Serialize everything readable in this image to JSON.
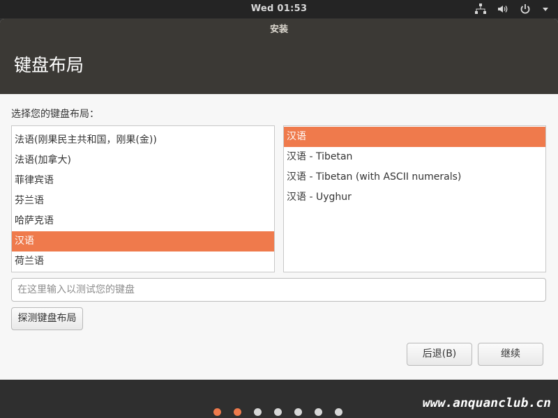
{
  "topbar": {
    "clock": "Wed 01:53",
    "icons": [
      "network-icon",
      "volume-icon",
      "power-icon",
      "chevron-down-icon"
    ]
  },
  "window": {
    "title": "安装",
    "header": "键盘布局",
    "prompt": "选择您的键盘布局：",
    "layouts": [
      {
        "label": "法语(刚果民主共和国，刚果(金))",
        "selected": false
      },
      {
        "label": "法语(加拿大)",
        "selected": false
      },
      {
        "label": "菲律宾语",
        "selected": false
      },
      {
        "label": "芬兰语",
        "selected": false
      },
      {
        "label": "哈萨克语",
        "selected": false
      },
      {
        "label": "汉语",
        "selected": true
      },
      {
        "label": "荷兰语",
        "selected": false
      }
    ],
    "variants": [
      {
        "label": "汉语",
        "selected": true
      },
      {
        "label": "汉语 - Tibetan",
        "selected": false
      },
      {
        "label": "汉语 - Tibetan (with ASCII numerals)",
        "selected": false
      },
      {
        "label": "汉语 - Uyghur",
        "selected": false
      }
    ],
    "test_input": {
      "value": "",
      "placeholder": "在这里输入以测试您的键盘"
    },
    "detect_button": "探测键盘布局",
    "back_button": "后退(B)",
    "continue_button": "继续"
  },
  "progress": {
    "total_steps": 7,
    "completed_steps": 2
  },
  "watermark": "www.anquanclub.cn",
  "colors": {
    "accent": "#ef7a4c",
    "titlebar": "#3b3935",
    "panel": "#242424"
  }
}
